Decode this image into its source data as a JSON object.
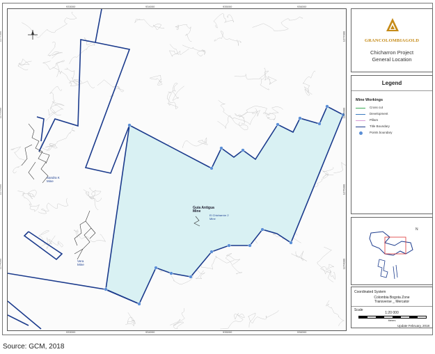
{
  "map": {
    "ticks_top": [
      "933000",
      "934000",
      "935000",
      "936000"
    ],
    "ticks_bottom": [
      "933000",
      "934000",
      "935000",
      "936000"
    ],
    "ticks_left": [
      "1277000",
      "1276000",
      "1275000",
      "1274000"
    ],
    "ticks_right": [
      "1277000",
      "1276000",
      "1275000",
      "1274000"
    ],
    "labels": {
      "sandra_k": "Sandra K\nMine",
      "vera": "Vera\nMine",
      "guia_antigua": "Guía Antigua\nMine",
      "el_chicharron": "El Chicharrón 2\nMine"
    },
    "colors": {
      "title_boundary": "#1a3a8c",
      "project_area_fill": "#d9f1f3",
      "point_marker": "#5b8fd6",
      "contours": "#c9c9c9"
    }
  },
  "sidebar": {
    "logo_text": "GRANCOLOMBIAGOLD",
    "project_title": "Chicharron Project\nGeneral Location",
    "legend_title": "Legend",
    "legend_section": "Mine Workings",
    "legend_items": [
      {
        "label": "Cross cut",
        "color": "#3aaa55"
      },
      {
        "label": "Development",
        "color": "#3a7bbf"
      },
      {
        "label": "Pillars",
        "color": "#d59ad5"
      },
      {
        "label": "Title Boundary",
        "color": "#1a3a8c"
      },
      {
        "label": "Points boundary",
        "color": "#5b8fd6"
      }
    ],
    "coord_label": "Coordinated System",
    "coord_zone": "Colombia Bogota Zone",
    "coord_proj": "Transverse _ Mercator",
    "scale_label": "Scale",
    "scale_value": "1:20 000",
    "scale_units": "Meters",
    "update": "Update February, 2018"
  },
  "caption": "Source: GCM, 2018"
}
